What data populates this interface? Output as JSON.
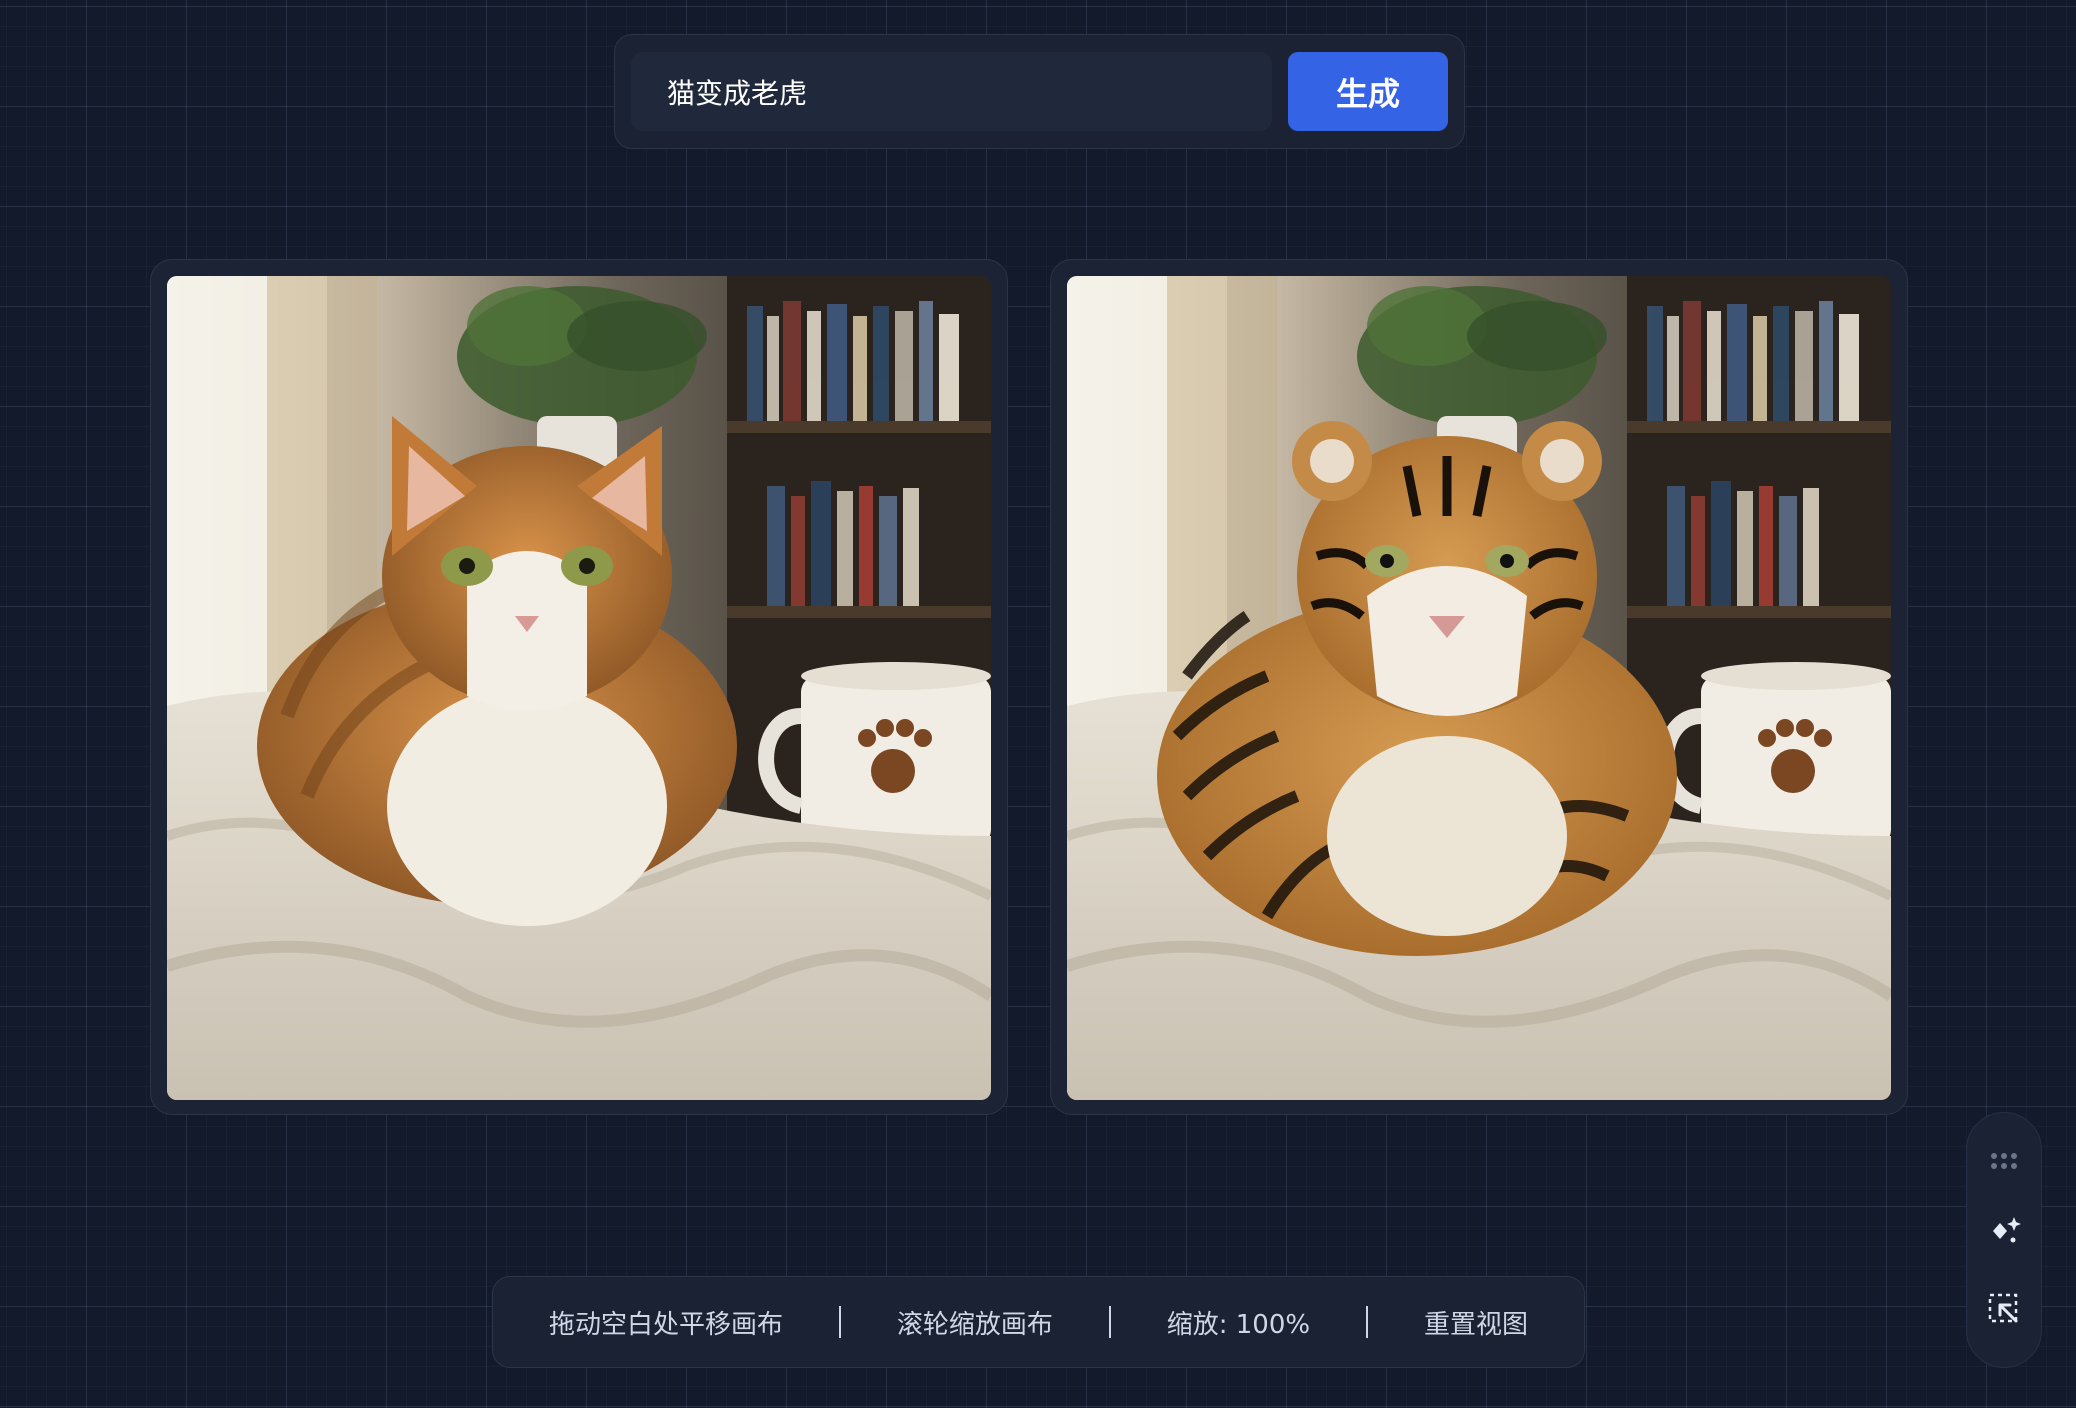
{
  "prompt": {
    "value": "猫变成老虎",
    "generate_label": "生成"
  },
  "images": {
    "original": {
      "subject": "cat"
    },
    "result": {
      "subject": "tiger"
    }
  },
  "toolbar": {
    "pan_hint": "拖动空白处平移画布",
    "scroll_hint": "滚轮缩放画布",
    "zoom": "缩放: 100%",
    "reset": "重置视图"
  },
  "dock": {
    "tools": [
      "grip-dots-icon",
      "sparkle-icon",
      "select-arrow-icon"
    ]
  },
  "colors": {
    "background": "#131a2b",
    "panel": "#1b2234",
    "accent": "#3563e6"
  }
}
